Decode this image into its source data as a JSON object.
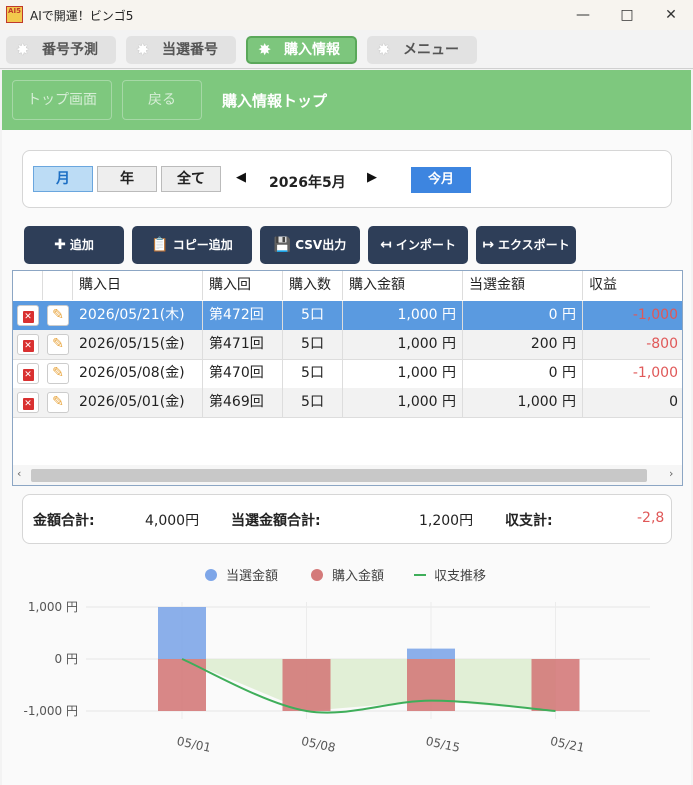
{
  "window": {
    "title": "AIで開運！ビンゴ5",
    "logo": "AI5",
    "minimize_icon": "minimize-icon",
    "maximize_icon": "maximize-icon",
    "close_icon": "close-icon"
  },
  "tabs": [
    {
      "label": "番号予測",
      "active": false
    },
    {
      "label": "当選番号",
      "active": false
    },
    {
      "label": "購入情報",
      "active": true
    },
    {
      "label": "メニュー",
      "active": false
    }
  ],
  "subbar": {
    "top_button": "トップ画面",
    "back_button": "戻る",
    "title": "購入情報トップ"
  },
  "period": {
    "month": "月",
    "year": "年",
    "all": "全て",
    "current": "2026年5月",
    "today": "今月",
    "selected": "月"
  },
  "actions": {
    "add": "追加",
    "copy_add": "コピー追加",
    "csv": "CSV出力",
    "import": "インポート",
    "export": "エクスポート"
  },
  "table": {
    "headers": [
      "購入日",
      "購入回",
      "購入数",
      "購入金額",
      "当選金額",
      "収益"
    ],
    "rows": [
      {
        "date": "2026/05/21(木)",
        "round": "第472回",
        "count": "5口",
        "cost": "1,000 円",
        "win": "0 円",
        "profit": "-1,000",
        "selected": true
      },
      {
        "date": "2026/05/15(金)",
        "round": "第471回",
        "count": "5口",
        "cost": "1,000 円",
        "win": "200 円",
        "profit": "-800",
        "selected": false
      },
      {
        "date": "2026/05/08(金)",
        "round": "第470回",
        "count": "5口",
        "cost": "1,000 円",
        "win": "0 円",
        "profit": "-1,000",
        "selected": false
      },
      {
        "date": "2026/05/01(金)",
        "round": "第469回",
        "count": "5口",
        "cost": "1,000 円",
        "win": "1,000 円",
        "profit": "0",
        "selected": false
      }
    ]
  },
  "summary": {
    "cost_label": "金額合計:",
    "cost_value": "4,000円",
    "win_label": "当選金額合計:",
    "win_value": "1,200円",
    "balance_label": "収支計:",
    "balance_value": "-2,8"
  },
  "colors": {
    "accent_green": "#7ec87e",
    "win": "#7ea6e8",
    "cost": "#d47a7a",
    "trend": "#3fae5a",
    "negative": "#e05858"
  },
  "chart_data": {
    "type": "bar",
    "categories": [
      "05/01",
      "05/08",
      "05/15",
      "05/21"
    ],
    "series": [
      {
        "name": "当選金額",
        "values": [
          1000,
          0,
          200,
          0
        ]
      },
      {
        "name": "購入金額",
        "values": [
          -1000,
          -1000,
          -1000,
          -1000
        ]
      },
      {
        "name": "収支推移",
        "type": "line",
        "values": [
          0,
          -1000,
          -800,
          -1000
        ]
      }
    ],
    "yticks": [
      "1,000 円",
      "0 円",
      "-1,000 円"
    ],
    "ylim": [
      -1000,
      1000
    ],
    "legend": "top"
  }
}
